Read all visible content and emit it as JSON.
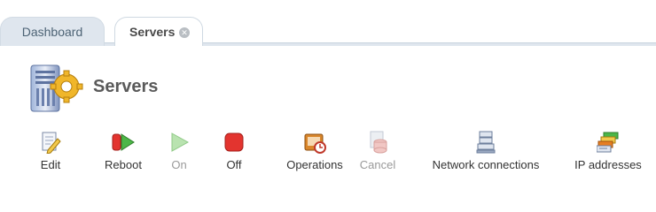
{
  "tabs": [
    {
      "label": "Dashboard",
      "active": false
    },
    {
      "label": "Servers",
      "active": true,
      "closable": true
    }
  ],
  "page": {
    "title": "Servers",
    "icon": "server-gear-icon"
  },
  "toolbar": [
    {
      "label": "Edit",
      "icon": "edit-icon",
      "enabled": true
    },
    {
      "label": "Reboot",
      "icon": "reboot-icon",
      "enabled": true
    },
    {
      "label": "On",
      "icon": "power-on-icon",
      "enabled": false
    },
    {
      "label": "Off",
      "icon": "power-off-icon",
      "enabled": true
    },
    {
      "label": "Operations",
      "icon": "operations-icon",
      "enabled": true
    },
    {
      "label": "Cancel",
      "icon": "cancel-icon",
      "enabled": false
    },
    {
      "label": "Network connections",
      "icon": "network-connections-icon",
      "enabled": true
    },
    {
      "label": "IP addresses",
      "icon": "ip-addresses-icon",
      "enabled": true
    }
  ],
  "colors": {
    "tab_inactive_bg": "#dfe6ee",
    "title_text": "#5a5a5a",
    "disabled_text": "#9a9a9a",
    "stop_red": "#e3342f",
    "play_green": "#4cb648"
  }
}
